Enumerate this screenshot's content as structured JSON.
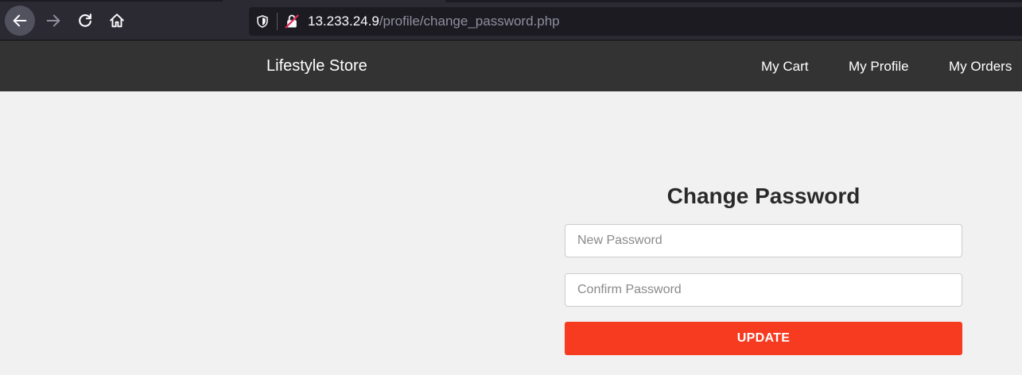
{
  "browser": {
    "url_host": "13.233.24.9",
    "url_path": "/profile/change_password.php",
    "icons": [
      "back-arrow-icon",
      "forward-arrow-icon",
      "reload-icon",
      "home-icon",
      "shield-icon",
      "insecure-lock-icon"
    ]
  },
  "site_nav": {
    "brand": "Lifestyle Store",
    "links": [
      {
        "label": "My Cart"
      },
      {
        "label": "My Profile"
      },
      {
        "label": "My Orders"
      }
    ]
  },
  "form": {
    "title": "Change Password",
    "new_password_placeholder": "New Password",
    "confirm_password_placeholder": "Confirm Password",
    "submit_label": "UPDATE"
  },
  "colors": {
    "navbar_bg": "#333333",
    "page_bg": "#f1f1f1",
    "button_accent": "#f73b21"
  }
}
